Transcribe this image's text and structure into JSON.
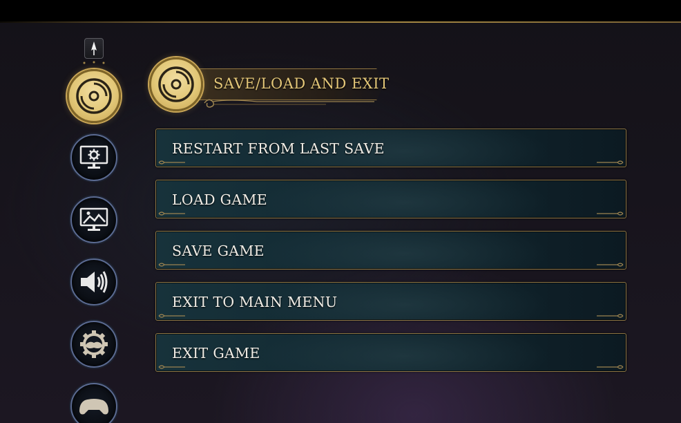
{
  "header": {
    "title": "SAVE/LOAD AND EXIT"
  },
  "sidebar": {
    "items": [
      {
        "id": "save-load-exit",
        "icon": "disc-icon",
        "active": true
      },
      {
        "id": "display-settings",
        "icon": "monitor-gear-icon",
        "active": false
      },
      {
        "id": "graphics",
        "icon": "monitor-image-icon",
        "active": false
      },
      {
        "id": "audio",
        "icon": "speaker-icon",
        "active": false
      },
      {
        "id": "gameplay",
        "icon": "gear-cogwheel-icon",
        "active": false
      },
      {
        "id": "controls",
        "icon": "gamepad-icon",
        "active": false
      }
    ],
    "scroll_up_icon": "arrow-up-icon"
  },
  "menu": {
    "items": [
      {
        "label": "RESTART FROM LAST SAVE"
      },
      {
        "label": "LOAD GAME"
      },
      {
        "label": "SAVE GAME"
      },
      {
        "label": "EXIT TO MAIN MENU"
      },
      {
        "label": "EXIT GAME"
      }
    ]
  },
  "colors": {
    "accent_gold": "#e3c678",
    "button_bg": "#132a33",
    "button_border": "#8d7644",
    "ring_blue": "#5b6b92"
  }
}
